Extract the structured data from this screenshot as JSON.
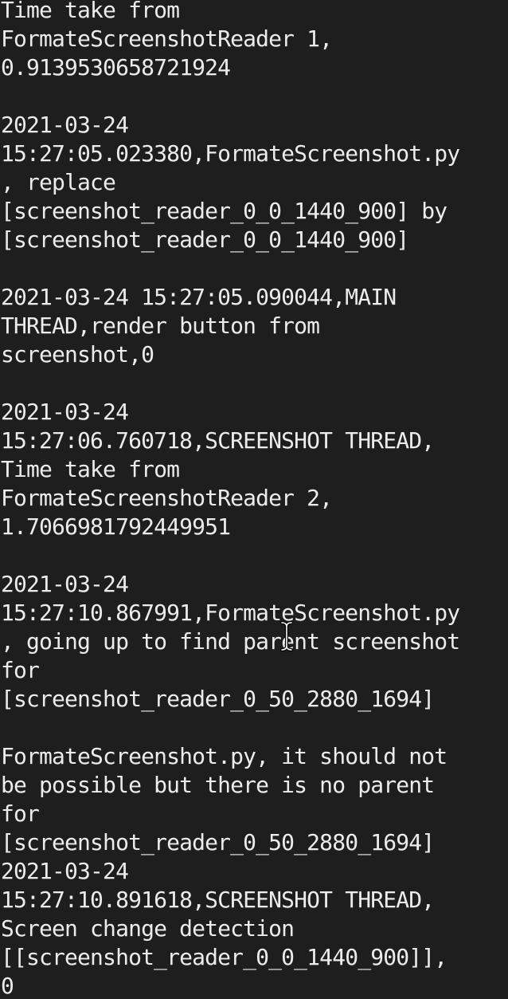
{
  "terminal": {
    "lines": [
      "Time take from",
      "FormateScreenshotReader 1,",
      "0.9139530658721924",
      "",
      "2021-03-24",
      "15:27:05.023380,FormateScreenshot.py",
      ", replace",
      "[screenshot_reader_0_0_1440_900] by",
      "[screenshot_reader_0_0_1440_900]",
      "",
      "2021-03-24 15:27:05.090044,MAIN",
      "THREAD,render button from",
      "screenshot,0",
      "",
      "2021-03-24",
      "15:27:06.760718,SCREENSHOT THREAD,",
      "Time take from",
      "FormateScreenshotReader 2,",
      "1.7066981792449951",
      "",
      "2021-03-24",
      "15:27:10.867991,FormateScreenshot.py",
      ", going up to find parent screenshot",
      "for",
      "[screenshot_reader_0_50_2880_1694]",
      "",
      "FormateScreenshot.py, it should not",
      "be possible but there is no parent",
      "for",
      "[screenshot_reader_0_50_2880_1694]",
      "2021-03-24",
      "15:27:10.891618,SCREENSHOT THREAD,",
      "Screen change detection",
      "[[screenshot_reader_0_0_1440_900]],",
      "0"
    ],
    "background_color": "#1e1e1e",
    "text_color": "#ececec",
    "cursor_icon": "ibeam-cursor-icon"
  }
}
